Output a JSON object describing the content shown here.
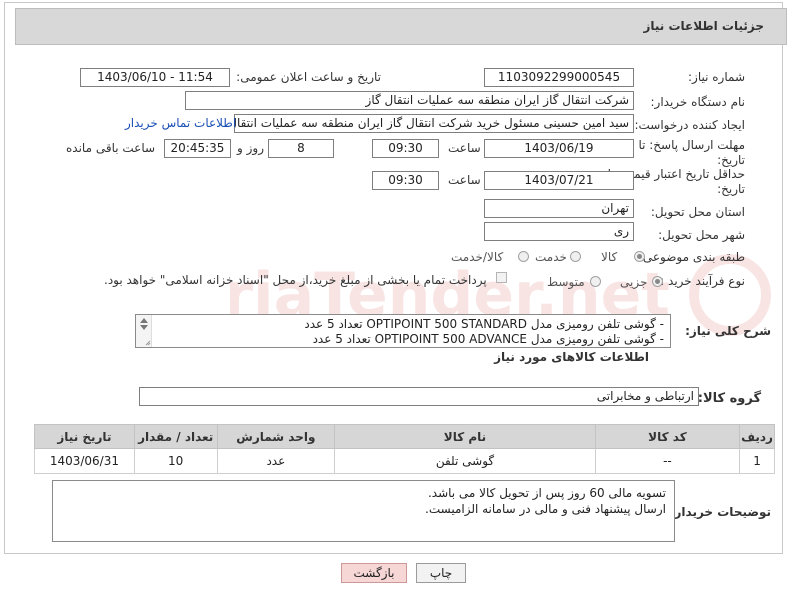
{
  "header": {
    "title": "جزئیات اطلاعات نیاز"
  },
  "fields": {
    "need_number": {
      "label": "شماره نیاز:",
      "value": "1103092299000545"
    },
    "announce_datetime": {
      "label": "تاریخ و ساعت اعلان عمومی:",
      "value": "1403/06/10 - 11:54"
    },
    "buyer_org": {
      "label": "نام دستگاه خریدار:",
      "value": "شرکت انتقال گاز ایران منطقه سه عملیات انتقال گاز"
    },
    "requester": {
      "label": "ایجاد کننده درخواست:",
      "value": "سید امین حسینی مسئول خرید شرکت انتقال گاز ایران منطقه سه عملیات انتقال گاز",
      "contact_link": "اطلاعات تماس خریدار"
    },
    "reply_deadline": {
      "label_line1": "مهلت ارسال پاسخ: تا",
      "label_line2": "تاریخ:",
      "date": "1403/06/19",
      "time_label": "ساعت",
      "time": "09:30",
      "days": "8",
      "days_label": "روز و",
      "remaining": "20:45:35",
      "remaining_label": "ساعت باقی مانده"
    },
    "price_validity": {
      "label_line1": "حداقل تاریخ اعتبار قیمت: تا",
      "label_line2": "تاریخ:",
      "date": "1403/07/21",
      "time_label": "ساعت",
      "time": "09:30"
    },
    "province": {
      "label": "استان محل تحویل:",
      "value": "تهران"
    },
    "city": {
      "label": "شهر محل تحویل:",
      "value": "ری"
    },
    "category": {
      "label": "طبقه بندی موضوعی:",
      "options": [
        "کالا",
        "خدمت",
        "کالا/خدمت"
      ],
      "selected": "کالا"
    },
    "purchase_type": {
      "label": "نوع فرآیند خرید :",
      "options": [
        "جزیی",
        "متوسط"
      ],
      "selected": "جزیی",
      "note": "پرداخت تمام یا بخشی از مبلغ خرید،از محل \"اسناد خزانه اسلامی\" خواهد بود."
    }
  },
  "description": {
    "label": "شرح کلی نیاز:",
    "lines": [
      "- گوشی تلفن رومیزی مدل   OPTIPOINT 500  STANDARD   تعداد 5 عدد",
      "- گوشی تلفن رومیزی مدل   OPTIPOINT 500 ADVANCE      تعداد 5 عدد"
    ]
  },
  "goods_section": {
    "title": "اطلاعات کالاهای مورد نیاز",
    "group_label": "گروه کالا:",
    "group_value": "ارتباطی و مخابراتی"
  },
  "table": {
    "headers": [
      "ردیف",
      "کد کالا",
      "نام کالا",
      "واحد شمارش",
      "تعداد / مقدار",
      "تاریخ نیاز"
    ],
    "rows": [
      [
        "1",
        "--",
        "گوشی تلفن",
        "عدد",
        "10",
        "1403/06/31"
      ]
    ]
  },
  "buyer_notes": {
    "label": "توضیحات خریدار:",
    "lines": [
      "تسویه مالی 60 روز پس از تحویل کالا می باشد.",
      "ارسال پیشنهاد فنی و مالی در سامانه الزامیست."
    ]
  },
  "buttons": {
    "print": "چاپ",
    "back": "بازگشت"
  },
  "watermark": {
    "text": "AriaTender.net"
  },
  "colors": {
    "header_bg": "#d8d8d8",
    "link": "#1a4fb5",
    "back_button_bg": "#f7d6d6"
  }
}
